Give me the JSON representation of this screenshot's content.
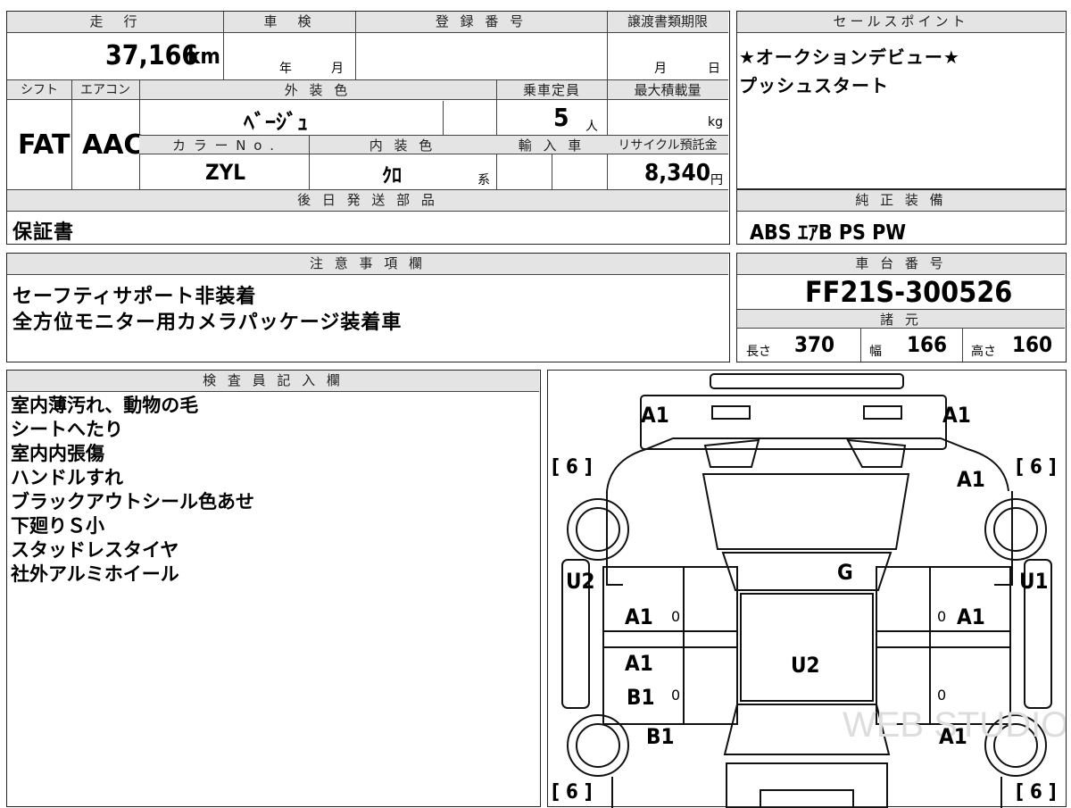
{
  "spec": {
    "mileage_label": "走　行",
    "mileage": "37,166",
    "mileage_unit": "km",
    "inspection_label": "車　検",
    "inspection_year": "年",
    "inspection_month": "月",
    "registration_label": "登 録 番 号",
    "transfer_label": "譲渡書類期限",
    "transfer_month": "月",
    "transfer_day": "日",
    "shift_label": "シフト",
    "shift": "FAT",
    "ac_label": "エアコン",
    "ac": "AAC",
    "exterior_color_label": "外 装 色",
    "exterior_color": "ﾍﾞｰｼﾞｭ",
    "capacity_label": "乗車定員",
    "capacity": "5",
    "capacity_unit": "人",
    "max_load_label": "最大積載量",
    "max_load_unit": "kg",
    "color_no_label": "カ ラ ー N o .",
    "color_no": "ZYL",
    "interior_color_label": "内 装 色",
    "interior_color": "ｸﾛ",
    "interior_suffix": "系",
    "import_label": "輸 入 車",
    "recycle_label": "リサイクル預託金",
    "recycle_fee": "8,340",
    "recycle_unit": "円",
    "later_parts_label": "後 日 発 送 部 品",
    "later_parts": "保証書"
  },
  "sales": {
    "label": "セールスポイント",
    "lines": [
      "★オークションデビュー★",
      "プッシュスタート"
    ]
  },
  "equipment": {
    "label": "純 正 装 備",
    "value": "ABS ｴｱB PS PW"
  },
  "notes": {
    "label": "注 意 事 項 欄",
    "lines": [
      "セーフティサポート非装着",
      "全方位モニター用カメラパッケージ装着車"
    ]
  },
  "chassis": {
    "label": "車 台 番 号",
    "value": "FF21S-300526"
  },
  "dims": {
    "label": "諸 元",
    "length_label": "長さ",
    "length": "370",
    "width_label": "幅",
    "width": "166",
    "height_label": "高さ",
    "height": "160"
  },
  "inspector": {
    "label": "検 査 員 記 入 欄",
    "lines": [
      "室内薄汚れ、動物の毛",
      "シートへたり",
      "室内内張傷",
      "ハンドルすれ",
      "ブラックアウトシール色あせ",
      "下廻りＳ小",
      "スタッドレスタイヤ",
      "社外アルミホイール"
    ]
  },
  "diagram": {
    "marks": {
      "front_left": "A1",
      "front_right": "A1",
      "right_fender": "A1",
      "left_quarter": "U2",
      "right_quarter": "U1",
      "hood": "G",
      "left_front_door": "A1",
      "right_front_door": "A1",
      "roof": "U2",
      "left_rear_door": "A1",
      "left_rocker": "B1",
      "left_rear": "B1",
      "right_rear": "A1"
    },
    "tires": {
      "tl": "6",
      "tr": "6",
      "bl": "6",
      "br": "6"
    },
    "zeros": [
      "0",
      "0",
      "0",
      "0"
    ],
    "watermark": "WEB STUDIO"
  }
}
